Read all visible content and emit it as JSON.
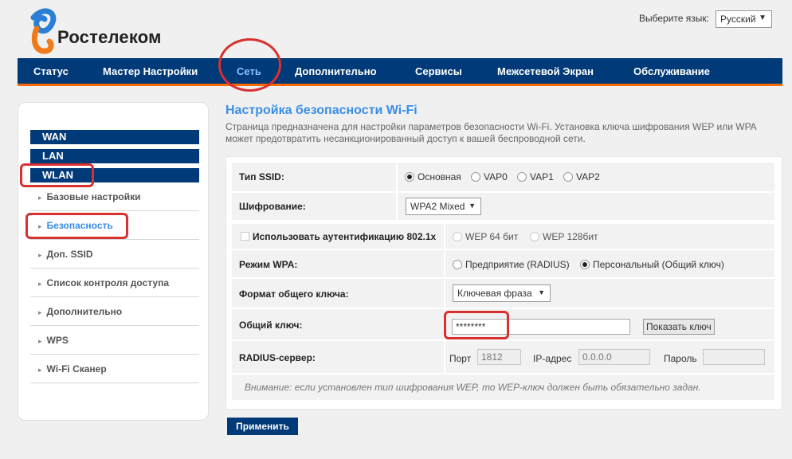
{
  "brand": {
    "name": "Ростелеком"
  },
  "language": {
    "label": "Выберите язык:",
    "selected": "Русский"
  },
  "nav": {
    "items": [
      "Статус",
      "Мастер Настройки",
      "Сеть",
      "Дополнительно",
      "Сервисы",
      "Межсетевой Экран",
      "Обслуживание"
    ]
  },
  "sidebar": {
    "groups": [
      "WAN",
      "LAN",
      "WLAN"
    ],
    "items": [
      "Базовые настройки",
      "Безопасность",
      "Доп. SSID",
      "Список контроля доступа",
      "Дополнительно",
      "WPS",
      "Wi-Fi Сканер"
    ]
  },
  "page": {
    "title": "Настройка безопасности Wi-Fi",
    "description": "Страница предназначена для настройки параметров безопасности Wi-Fi. Установка ключа шифрования WEP или WPA может предотвратить несанкционированный доступ к вашей беспроводной сети."
  },
  "form": {
    "ssid_type": {
      "label": "Тип SSID:",
      "options": [
        "Основная",
        "VAP0",
        "VAP1",
        "VAP2"
      ],
      "selected": "Основная"
    },
    "encryption": {
      "label": "Шифрование:",
      "value": "WPA2 Mixed"
    },
    "auth8021x": {
      "label": "Использовать аутентификацию 802.1x",
      "options": [
        "WEP 64 бит",
        "WEP 128бит"
      ]
    },
    "wpa_mode": {
      "label": "Режим WPA:",
      "options": [
        "Предприятие (RADIUS)",
        "Персональный (Общий ключ)"
      ],
      "selected": "Персональный (Общий ключ)"
    },
    "key_format": {
      "label": "Формат общего ключа:",
      "value": "Ключевая фраза"
    },
    "shared_key": {
      "label": "Общий ключ:",
      "value": "********",
      "show_button": "Показать ключ"
    },
    "radius": {
      "label": "RADIUS-сервер:",
      "port_label": "Порт",
      "port": "1812",
      "ip_label": "IP-адрес",
      "ip": "0.0.0.0",
      "password_label": "Пароль",
      "password": ""
    },
    "note": "Внимание: если установлен тип шифрования WEP, то WEP-ключ должен быть обязательно задан."
  },
  "apply_button": "Применить",
  "colors": {
    "nav": "#003a78",
    "accent": "#3a8ee6",
    "annotation": "#d93030"
  }
}
